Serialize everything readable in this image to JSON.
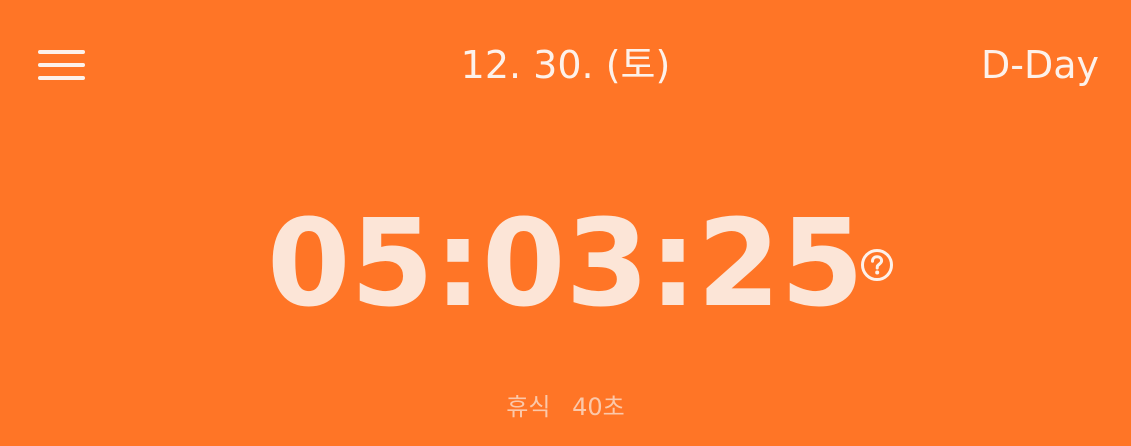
{
  "header": {
    "menu_icon": "hamburger-menu-icon",
    "date": "12. 30. (토)",
    "dday_label": "D-Day"
  },
  "timer": {
    "value": "05:03:25",
    "help_icon": "question-circle-icon"
  },
  "rest": {
    "label": "휴식",
    "value": "40초"
  },
  "colors": {
    "background": "#FF7526",
    "text": "#FDF1EA",
    "timer_text": "#FCE5D7",
    "muted_text": "#FBC8AA"
  }
}
